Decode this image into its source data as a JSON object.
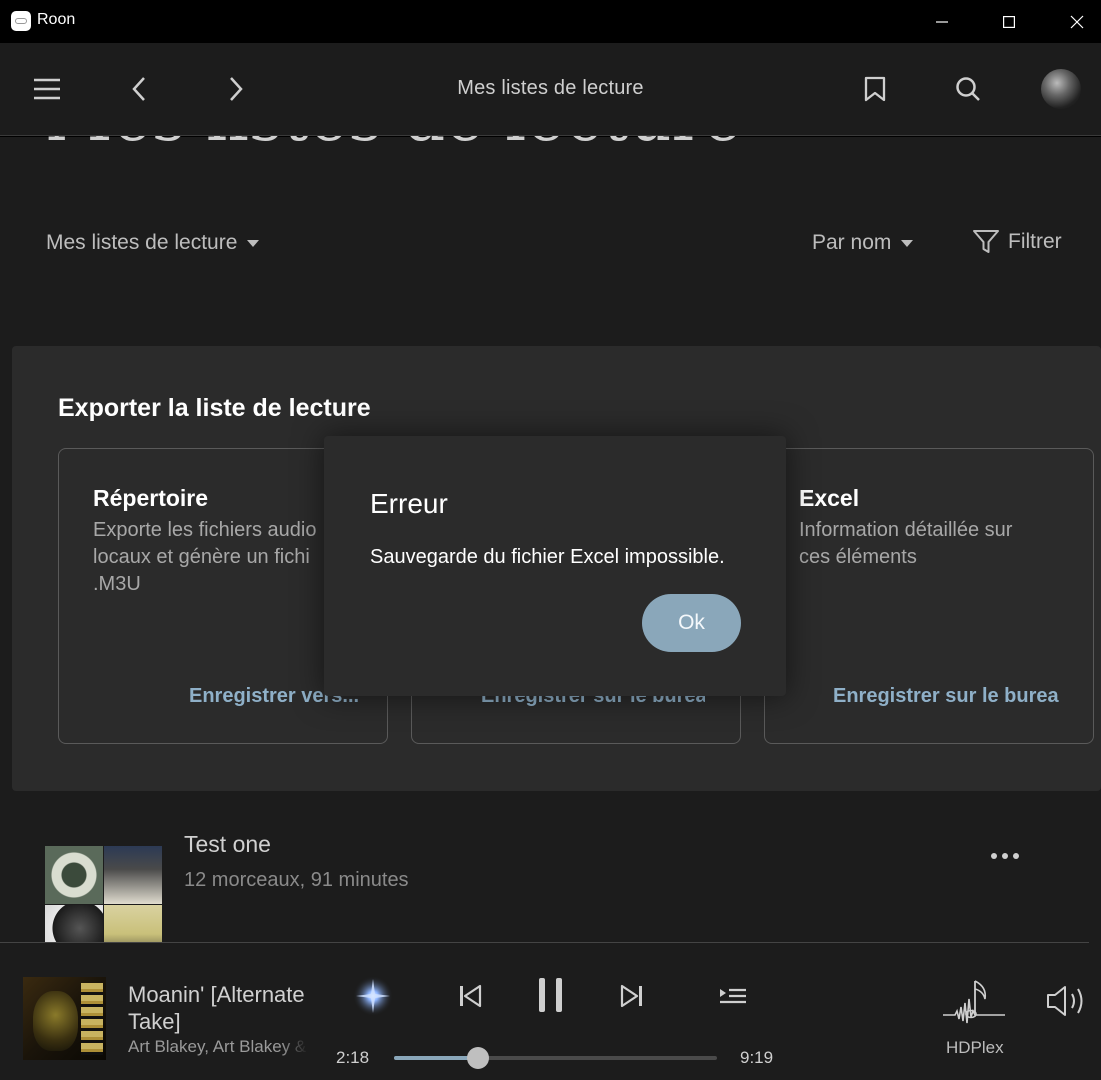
{
  "window": {
    "title": "Roon"
  },
  "navbar": {
    "title": "Mes listes de lecture",
    "icons": [
      "menu-icon",
      "back-icon",
      "forward-icon",
      "bookmark-icon",
      "search-icon",
      "avatar"
    ]
  },
  "page": {
    "big_title": "Mes listes de lecture",
    "scope_label": "Mes listes de lecture",
    "sort_label": "Par nom",
    "filter_label": "Filtrer"
  },
  "playlists": [
    {
      "title": "Test one",
      "meta": "12 morceaux, 91 minutes"
    }
  ],
  "export_panel": {
    "title": "Exporter la liste de lecture",
    "cards": [
      {
        "title": "Répertoire",
        "description": "Exporte les fichiers audio\nlocaux et génère un fichi\n.M3U",
        "action": "Enregistrer vers..."
      },
      {
        "title": "",
        "description": "",
        "action": "Enregistrer sur le bureau"
      },
      {
        "title": "Excel",
        "description": "Information détaillée sur\nces éléments",
        "action": "Enregistrer sur le bureau"
      }
    ]
  },
  "error_dialog": {
    "title": "Erreur",
    "message": "Sauvegarde du fichier Excel impossible.",
    "ok_label": "Ok"
  },
  "player": {
    "track_title": "Moanin' [Alternate Take]",
    "artist": "Art Blakey, Art Blakey & The Jazz Messengers",
    "elapsed": "2:18",
    "duration": "9:19",
    "progress_fraction": 0.26,
    "zone": "HDPlex",
    "colors": {
      "accent": "#8aa7ba"
    }
  }
}
